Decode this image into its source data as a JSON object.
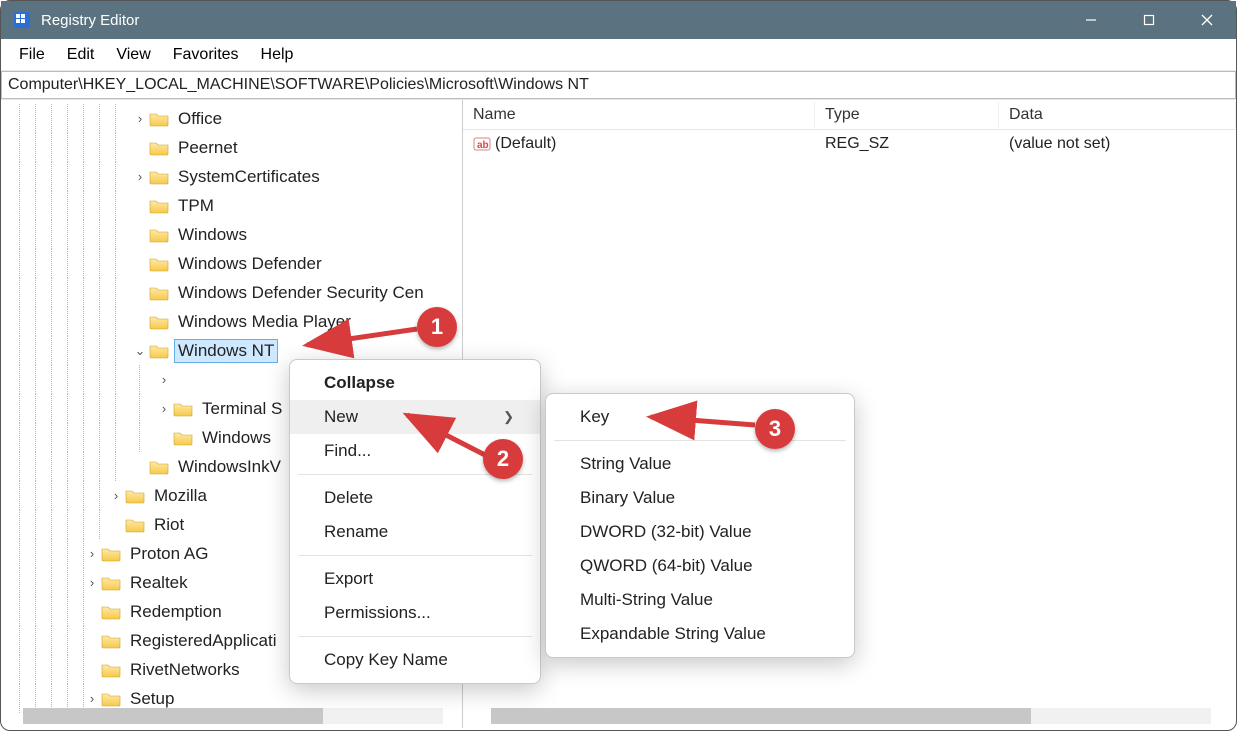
{
  "window": {
    "title": "Registry Editor"
  },
  "menubar": [
    "File",
    "Edit",
    "View",
    "Favorites",
    "Help"
  ],
  "address": "Computer\\HKEY_LOCAL_MACHINE\\SOFTWARE\\Policies\\Microsoft\\Windows NT",
  "tree": [
    {
      "indent": 130,
      "lines": [
        18,
        34,
        50,
        66,
        82,
        98,
        114
      ],
      "exp": ">",
      "label": "Office"
    },
    {
      "indent": 130,
      "lines": [
        18,
        34,
        50,
        66,
        82,
        98,
        114
      ],
      "exp": "",
      "label": "Peernet"
    },
    {
      "indent": 130,
      "lines": [
        18,
        34,
        50,
        66,
        82,
        98,
        114
      ],
      "exp": ">",
      "label": "SystemCertificates"
    },
    {
      "indent": 130,
      "lines": [
        18,
        34,
        50,
        66,
        82,
        98,
        114
      ],
      "exp": "",
      "label": "TPM"
    },
    {
      "indent": 130,
      "lines": [
        18,
        34,
        50,
        66,
        82,
        98,
        114
      ],
      "exp": "",
      "label": "Windows"
    },
    {
      "indent": 130,
      "lines": [
        18,
        34,
        50,
        66,
        82,
        98,
        114
      ],
      "exp": "",
      "label": "Windows Defender"
    },
    {
      "indent": 130,
      "lines": [
        18,
        34,
        50,
        66,
        82,
        98,
        114
      ],
      "exp": "",
      "label": "Windows Defender Security Cen"
    },
    {
      "indent": 130,
      "lines": [
        18,
        34,
        50,
        66,
        82,
        98,
        114
      ],
      "exp": "",
      "label": "Windows Media Player"
    },
    {
      "indent": 130,
      "lines": [
        18,
        34,
        50,
        66,
        82,
        98,
        114
      ],
      "exp": "v",
      "label": "Windows NT",
      "selected": true
    },
    {
      "indent": 154,
      "lines": [
        18,
        34,
        50,
        66,
        82,
        98,
        114,
        138
      ],
      "exp": ">",
      "label": ""
    },
    {
      "indent": 154,
      "lines": [
        18,
        34,
        50,
        66,
        82,
        98,
        114,
        138
      ],
      "exp": ">",
      "label": "Terminal S"
    },
    {
      "indent": 154,
      "lines": [
        18,
        34,
        50,
        66,
        82,
        98,
        114,
        138
      ],
      "exp": "",
      "label": "Windows"
    },
    {
      "indent": 130,
      "lines": [
        18,
        34,
        50,
        66,
        82,
        98,
        114
      ],
      "exp": "",
      "label": "WindowsInkV"
    },
    {
      "indent": 106,
      "lines": [
        18,
        34,
        50,
        66,
        82,
        98
      ],
      "exp": ">",
      "label": "Mozilla"
    },
    {
      "indent": 106,
      "lines": [
        18,
        34,
        50,
        66,
        82,
        98
      ],
      "exp": "",
      "label": "Riot"
    },
    {
      "indent": 82,
      "lines": [
        18,
        34,
        50,
        66,
        82
      ],
      "exp": ">",
      "label": "Proton AG"
    },
    {
      "indent": 82,
      "lines": [
        18,
        34,
        50,
        66,
        82
      ],
      "exp": ">",
      "label": "Realtek"
    },
    {
      "indent": 82,
      "lines": [
        18,
        34,
        50,
        66,
        82
      ],
      "exp": "",
      "label": "Redemption"
    },
    {
      "indent": 82,
      "lines": [
        18,
        34,
        50,
        66,
        82
      ],
      "exp": "",
      "label": "RegisteredApplicati"
    },
    {
      "indent": 82,
      "lines": [
        18,
        34,
        50,
        66,
        82
      ],
      "exp": "",
      "label": "RivetNetworks"
    },
    {
      "indent": 82,
      "lines": [
        18,
        34,
        50,
        66,
        82
      ],
      "exp": ">",
      "label": "Setup"
    }
  ],
  "list": {
    "headers": {
      "name": "Name",
      "type": "Type",
      "data": "Data"
    },
    "rows": [
      {
        "name": "(Default)",
        "type": "REG_SZ",
        "data": "(value not set)"
      }
    ]
  },
  "context_menu": {
    "collapse": "Collapse",
    "new": "New",
    "find": "Find...",
    "delete": "Delete",
    "rename": "Rename",
    "export": "Export",
    "permissions": "Permissions...",
    "copy_key_name": "Copy Key Name"
  },
  "submenu": {
    "key": "Key",
    "string": "String Value",
    "binary": "Binary Value",
    "dword": "DWORD (32-bit) Value",
    "qword": "QWORD (64-bit) Value",
    "multi": "Multi-String Value",
    "expand": "Expandable String Value"
  },
  "annotations": {
    "a1": "1",
    "a2": "2",
    "a3": "3"
  }
}
